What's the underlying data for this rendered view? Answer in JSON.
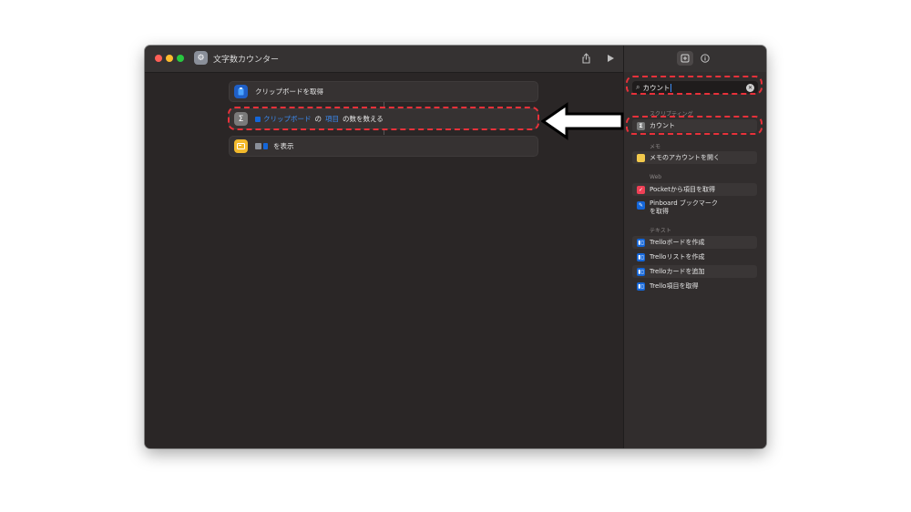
{
  "window": {
    "title": "文字数カウンター"
  },
  "workflow": {
    "actions": [
      {
        "label": "クリップボードを取得"
      },
      {
        "token1": "クリップボード",
        "connector1": "の",
        "token2": "項目",
        "suffix": "の数を数える"
      },
      {
        "suffix": "を表示"
      }
    ]
  },
  "sidebar": {
    "search": {
      "value": "カウント"
    },
    "sections": [
      {
        "title": "スクリプティング",
        "items": [
          {
            "label": "カウント",
            "icon": "sigma-icon"
          }
        ]
      },
      {
        "title": "メモ",
        "items": [
          {
            "label": "メモのアカウントを開く",
            "icon": "notes-icon"
          }
        ]
      },
      {
        "title": "Web",
        "items": [
          {
            "label": "Pocketから項目を取得",
            "icon": "pocket-icon"
          },
          {
            "label": "Pinboard ブックマーク\nを取得",
            "icon": "pinboard-icon"
          }
        ]
      },
      {
        "title": "テキスト",
        "items": [
          {
            "label": "Trelloボードを作成",
            "icon": "trello-icon"
          },
          {
            "label": "Trelloリストを作成",
            "icon": "trello-icon"
          },
          {
            "label": "Trelloカードを追加",
            "icon": "trello-icon"
          },
          {
            "label": "Trello項目を取得",
            "icon": "trello-icon"
          }
        ]
      }
    ]
  },
  "colors": {
    "annotation_red": "#e8313a",
    "variable_blue": "#3b8cf5",
    "trello_blue": "#1466d9",
    "notes_yellow": "#f2c94c"
  }
}
